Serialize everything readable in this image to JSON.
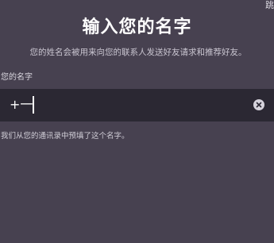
{
  "header": {
    "skip_label": "跳",
    "title": "输入您的名字",
    "subtitle": "您的姓名会被用来向您的联系人发送好友请求和推荐好友。"
  },
  "name_field": {
    "label": "您的名字",
    "value": "+一",
    "clear_icon": "clear-circle-icon"
  },
  "helper_text": "我们从您的通讯录中预填了这个名字。"
}
